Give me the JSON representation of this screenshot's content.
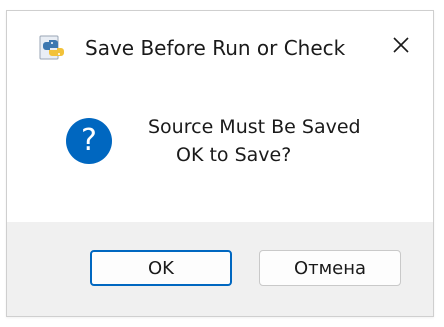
{
  "dialog": {
    "title": "Save Before Run or Check",
    "message_line1": "Source Must Be Saved",
    "message_line2": "OK to Save?",
    "icons": {
      "app": "python-icon",
      "question": "question-icon",
      "question_glyph": "?",
      "close": "close-icon"
    }
  },
  "buttons": {
    "ok_label": "OK",
    "cancel_label": "Отмена"
  },
  "colors": {
    "accent": "#0067c0",
    "footer_bg": "#f0f0f0",
    "python_blue": "#3d78b0",
    "python_yellow": "#f2c23a"
  }
}
